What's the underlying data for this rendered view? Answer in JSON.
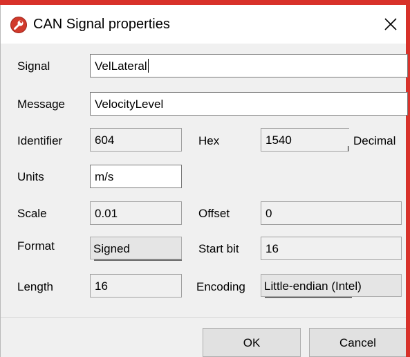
{
  "window": {
    "title": "CAN Signal properties"
  },
  "form": {
    "signal_label": "Signal",
    "signal_value": "VelLateral",
    "message_label": "Message",
    "message_value": "VelocityLevel",
    "identifier_label": "Identifier",
    "identifier_value": "604",
    "hex_label": "Hex",
    "decimal_value": "1540",
    "decimal_label": "Decimal",
    "units_label": "Units",
    "units_value": "m/s",
    "scale_label": "Scale",
    "scale_value": "0.01",
    "offset_label": "Offset",
    "offset_value": "0",
    "format_label": "Format",
    "format_value": "Signed",
    "startbit_label": "Start bit",
    "startbit_value": "16",
    "length_label": "Length",
    "length_value": "16",
    "encoding_label": "Encoding",
    "encoding_value": "Little-endian (Intel)"
  },
  "buttons": {
    "ok_label": "OK",
    "cancel_label": "Cancel"
  },
  "colors": {
    "accent_red": "#d8312a",
    "client_bg": "#f0f0f0",
    "title_bg": "#ffffff"
  },
  "icons": {
    "app": "wrench-badge-icon",
    "close": "close-icon"
  }
}
